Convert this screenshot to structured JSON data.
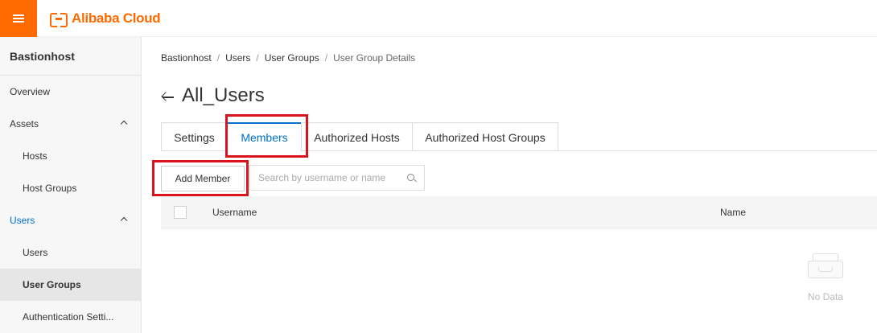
{
  "header": {
    "brand": "Alibaba Cloud"
  },
  "sidebar": {
    "title": "Bastionhost",
    "items": [
      {
        "label": "Overview"
      },
      {
        "label": "Assets"
      },
      {
        "label": "Hosts"
      },
      {
        "label": "Host Groups"
      },
      {
        "label": "Users"
      },
      {
        "label": "Users"
      },
      {
        "label": "User Groups"
      },
      {
        "label": "Authentication Setti..."
      }
    ]
  },
  "breadcrumb": {
    "items": [
      "Bastionhost",
      "Users",
      "User Groups",
      "User Group Details"
    ],
    "separator": "/"
  },
  "page": {
    "title": "All_Users"
  },
  "tabs": [
    {
      "label": "Settings"
    },
    {
      "label": "Members"
    },
    {
      "label": "Authorized Hosts"
    },
    {
      "label": "Authorized Host Groups"
    }
  ],
  "toolbar": {
    "add_member_label": "Add Member",
    "search_placeholder": "Search by username or name"
  },
  "table": {
    "columns": [
      "Username",
      "Name"
    ],
    "rows": [],
    "empty_text": "No Data"
  },
  "colors": {
    "brand": "#ff6a00",
    "link": "#0070cc",
    "highlight": "#d9141d"
  }
}
